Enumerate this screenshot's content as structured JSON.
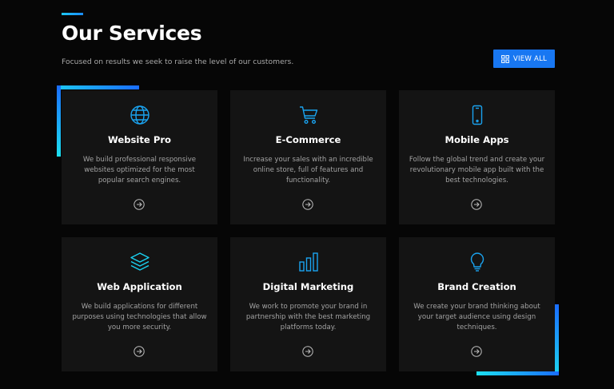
{
  "header": {
    "title": "Our Services",
    "subtitle": "Focused on results we seek to raise the level of our customers.",
    "view_all_label": "VIEW ALL"
  },
  "colors": {
    "background": "#060606",
    "card": "#141414",
    "accent_blue": "#1877f2",
    "accent_cyan": "#1cc7f2"
  },
  "services": [
    {
      "icon": "globe-icon",
      "title": "Website Pro",
      "description": "We build professional responsive websites optimized for the most popular search engines."
    },
    {
      "icon": "shopping-cart-icon",
      "title": "E-Commerce",
      "description": "Increase your sales with an incredible online store, full of features and functionality."
    },
    {
      "icon": "mobile-phone-icon",
      "title": "Mobile Apps",
      "description": "Follow the global trend and create your revolutionary mobile app built with the best technologies."
    },
    {
      "icon": "layers-icon",
      "title": "Web Application",
      "description": "We build applications for different purposes using technologies that allow you more security."
    },
    {
      "icon": "bar-chart-icon",
      "title": "Digital Marketing",
      "description": "We work to promote your brand in partnership with the best marketing platforms today."
    },
    {
      "icon": "lightbulb-icon",
      "title": "Brand Creation",
      "description": "We create your brand thinking about your target audience using design techniques."
    }
  ]
}
